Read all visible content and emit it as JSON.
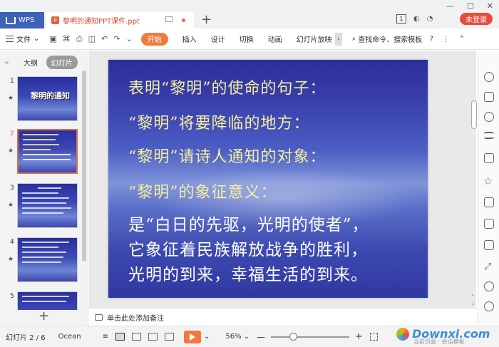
{
  "titlebar": {
    "wps_tab": "WPS",
    "doc_tab": "黎明的通知PPT课件.ppt",
    "badge": "1",
    "login": "未登录"
  },
  "toolbar": {
    "file_menu": "文件",
    "start": "开始",
    "tabs": [
      "插入",
      "设计",
      "切换",
      "动画",
      "幻灯片放映"
    ],
    "search": "查找命令、搜索模板"
  },
  "left_panel": {
    "outline_tab": "大纲",
    "slides_tab": "幻灯片",
    "thumbnails": [
      {
        "num": "1",
        "title": "黎明的通知"
      },
      {
        "num": "2",
        "title": ""
      },
      {
        "num": "3",
        "title": ""
      },
      {
        "num": "4",
        "title": ""
      },
      {
        "num": "5",
        "title": ""
      }
    ]
  },
  "slide": {
    "lines": [
      "表明“黎明”的使命的句子：",
      "“黎明”将要降临的地方：",
      "“黎明”请诗人通知的对象：",
      "“黎明”的象征意义：",
      "是“白日的先驱，光明的使者”，",
      "它象征着民族解放战争的胜利，",
      "光明的到来，幸福生活的到来。"
    ]
  },
  "notes": {
    "placeholder": "单击此处添加备注"
  },
  "statusbar": {
    "slide_info": "幻灯片 2 / 6",
    "theme": "Ocean",
    "zoom": "56%",
    "zoom_level": 0.28
  },
  "watermark": {
    "text": "Downxi.com",
    "sub": "当前页面 · 会话模板"
  },
  "colors": {
    "accent": "#f07a3c",
    "wps_blue": "#3c62b7",
    "login_red": "#e64d3d",
    "slide_text_yellow": "#f5ef9c"
  }
}
